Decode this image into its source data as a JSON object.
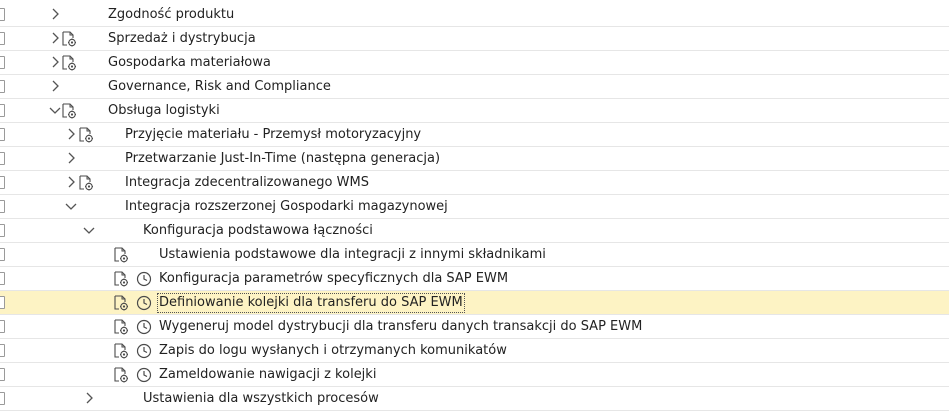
{
  "tree": {
    "nodes": [
      {
        "label": "Zgodność produktu",
        "level": 0,
        "expanded": false,
        "doc_icon": false,
        "clock_icon": false,
        "has_chevron": true
      },
      {
        "label": "Sprzedaż i dystrybucja",
        "level": 0,
        "expanded": false,
        "doc_icon": true,
        "clock_icon": false,
        "has_chevron": true
      },
      {
        "label": "Gospodarka materiałowa",
        "level": 0,
        "expanded": false,
        "doc_icon": true,
        "clock_icon": false,
        "has_chevron": true
      },
      {
        "label": "Governance, Risk and Compliance",
        "level": 0,
        "expanded": false,
        "doc_icon": false,
        "clock_icon": false,
        "has_chevron": true
      },
      {
        "label": "Obsługa logistyki",
        "level": 0,
        "expanded": true,
        "doc_icon": true,
        "clock_icon": false,
        "has_chevron": true
      },
      {
        "label": "Przyjęcie materiału - Przemysł motoryzacyjny",
        "level": 1,
        "expanded": false,
        "doc_icon": true,
        "clock_icon": false,
        "has_chevron": true
      },
      {
        "label": "Przetwarzanie Just-In-Time (następna generacja)",
        "level": 1,
        "expanded": false,
        "doc_icon": false,
        "clock_icon": false,
        "has_chevron": true
      },
      {
        "label": "Integracja zdecentralizowanego WMS",
        "level": 1,
        "expanded": false,
        "doc_icon": true,
        "clock_icon": false,
        "has_chevron": true
      },
      {
        "label": "Integracja rozszerzonej Gospodarki magazynowej",
        "level": 1,
        "expanded": true,
        "doc_icon": false,
        "clock_icon": false,
        "has_chevron": true
      },
      {
        "label": "Konfiguracja podstawowa łączności",
        "level": 2,
        "expanded": true,
        "doc_icon": false,
        "clock_icon": false,
        "has_chevron": true
      },
      {
        "label": "Ustawienia podstawowe dla integracji z innymi składnikami",
        "level": 3,
        "expanded": false,
        "doc_icon": true,
        "clock_icon": false,
        "has_chevron": false
      },
      {
        "label": "Konfiguracja parametrów specyficznych dla SAP EWM",
        "level": 3,
        "expanded": false,
        "doc_icon": true,
        "clock_icon": true,
        "has_chevron": false
      },
      {
        "label": "Definiowanie kolejki dla transferu do SAP EWM",
        "level": 3,
        "expanded": false,
        "doc_icon": true,
        "clock_icon": true,
        "has_chevron": false,
        "selected": true
      },
      {
        "label": "Wygeneruj model dystrybucji dla transferu danych transakcji do SAP EWM",
        "level": 3,
        "expanded": false,
        "doc_icon": true,
        "clock_icon": true,
        "has_chevron": false
      },
      {
        "label": "Zapis do logu wysłanych i otrzymanych komunikatów",
        "level": 3,
        "expanded": false,
        "doc_icon": true,
        "clock_icon": true,
        "has_chevron": false
      },
      {
        "label": "Zameldowanie nawigacji z kolejki",
        "level": 3,
        "expanded": false,
        "doc_icon": true,
        "clock_icon": true,
        "has_chevron": false
      },
      {
        "label": "Ustawienia dla wszystkich procesów",
        "level": 2,
        "expanded": false,
        "doc_icon": false,
        "clock_icon": false,
        "has_chevron": true
      }
    ]
  },
  "colors": {
    "selected_row": "#fdf3c4",
    "row_border": "#e6e6e6",
    "icon_stroke": "#4a4a4a",
    "chevron": "#555555"
  },
  "icons": {
    "document": "customizing-doc-icon",
    "clock": "clock-icon",
    "chevron_collapsed": "chevron-right-icon",
    "chevron_expanded": "chevron-down-icon"
  }
}
